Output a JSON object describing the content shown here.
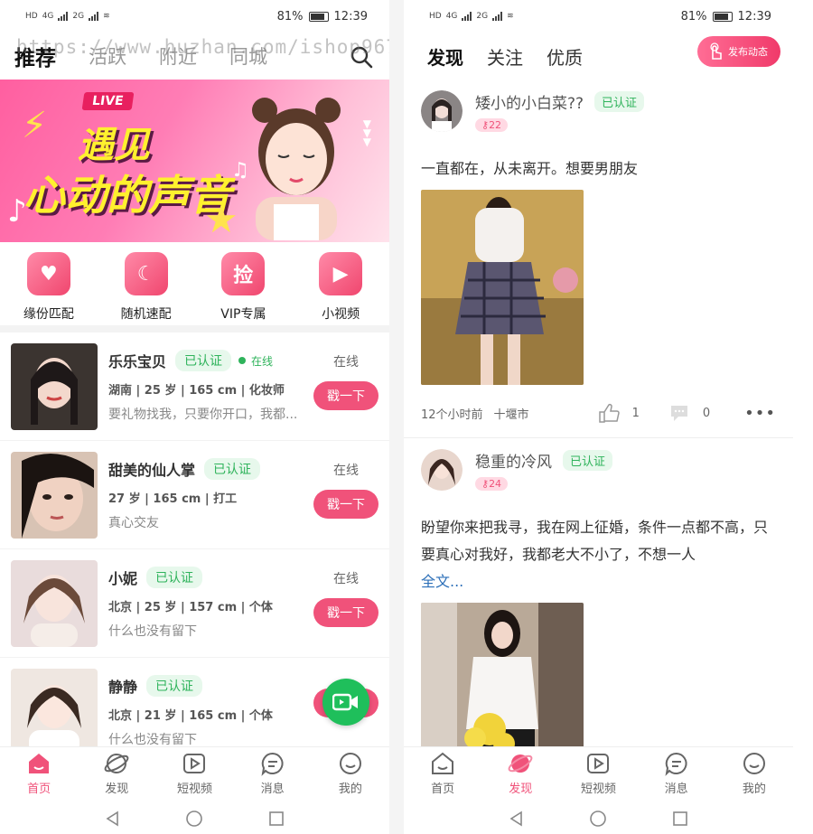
{
  "status": {
    "battery": "81%",
    "time": "12:39",
    "net1": "HD",
    "sig1": "4G",
    "sig2": "2G"
  },
  "left": {
    "tabs": [
      {
        "label": "推荐"
      },
      {
        "label": "活跃"
      },
      {
        "label": "附近"
      },
      {
        "label": "同城"
      }
    ],
    "watermark": "https://www.huzhan.com/ishop9677",
    "banner": {
      "live": "LIVE",
      "line1": "遇见",
      "line2": "心动的声音"
    },
    "features": [
      {
        "label": "缘份匹配",
        "glyph": "♥",
        "icon": "heart-icon"
      },
      {
        "label": "随机速配",
        "glyph": "☾",
        "icon": "moon-icon"
      },
      {
        "label": "VIP专属",
        "glyph": "捡",
        "icon": "vip-icon"
      },
      {
        "label": "小视频",
        "glyph": "▶",
        "icon": "play-icon"
      }
    ],
    "users": [
      {
        "name": "乐乐宝贝",
        "verified": "已认证",
        "online": "在线",
        "meta": "湖南 | 25 岁 | 165 cm | 化妆师",
        "desc": "要礼物找我，只要你开口，我都...",
        "status": "在线",
        "button": "戳一下"
      },
      {
        "name": "甜美的仙人掌",
        "verified": "已认证",
        "online": "",
        "meta": "27 岁 | 165 cm | 打工",
        "desc": "真心交友",
        "status": "在线",
        "button": "戳一下"
      },
      {
        "name": "小妮",
        "verified": "已认证",
        "online": "",
        "meta": "北京 | 25 岁 | 157 cm | 个体",
        "desc": "什么也没有留下",
        "status": "在线",
        "button": "戳一下"
      },
      {
        "name": "静静",
        "verified": "已认证",
        "online": "",
        "meta": "北京 | 21 岁 | 165 cm | 个体",
        "desc": "什么也没有留下",
        "status": "",
        "button": "戳一下"
      }
    ],
    "nav": [
      {
        "label": "首页",
        "active": true
      },
      {
        "label": "发现",
        "active": false
      },
      {
        "label": "短视频",
        "active": false
      },
      {
        "label": "消息",
        "active": false
      },
      {
        "label": "我的",
        "active": false
      }
    ]
  },
  "right": {
    "tabs": [
      {
        "label": "发现"
      },
      {
        "label": "关注"
      },
      {
        "label": "优质"
      }
    ],
    "publish": "发布动态",
    "posts": [
      {
        "name": "矮小的小白菜??",
        "verified": "已认证",
        "level": "22",
        "text": "一直都在，从未离开。想要男朋友",
        "more": "",
        "time": "12个小时前",
        "city": "十堰市",
        "likes": "1",
        "comments": "0"
      },
      {
        "name": "稳重的冷风",
        "verified": "已认证",
        "level": "24",
        "text": "盼望你来把我寻，我在网上征婚，条件一点都不高，只要真心对我好，我都老大不小了，不想一人",
        "more": "全文...",
        "time": "",
        "city": "",
        "likes": "",
        "comments": ""
      }
    ],
    "nav": [
      {
        "label": "首页",
        "active": false
      },
      {
        "label": "发现",
        "active": true
      },
      {
        "label": "短视频",
        "active": false
      },
      {
        "label": "消息",
        "active": false
      },
      {
        "label": "我的",
        "active": false
      }
    ]
  },
  "colors": {
    "accent": "#f0527a",
    "verified": "#2fb35b",
    "fab": "#1fbf5b"
  }
}
